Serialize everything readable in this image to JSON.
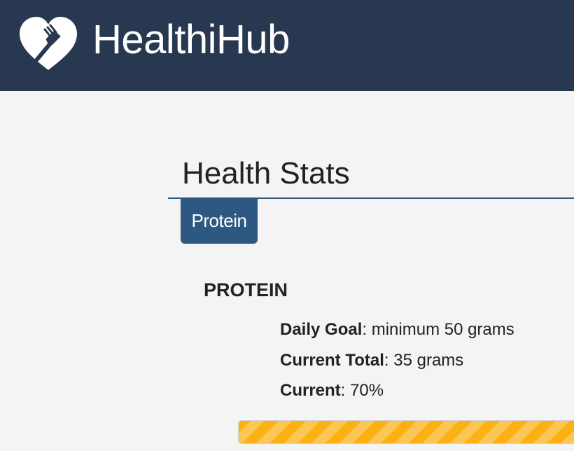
{
  "header": {
    "brand": "HealthiHub",
    "logo_icon": "heart-fork-icon",
    "background_color": "#283850"
  },
  "main": {
    "title": "Health Stats",
    "tabs": [
      {
        "label": "Protein",
        "active": true
      }
    ],
    "stat": {
      "heading": "PROTEIN",
      "rows": [
        {
          "label": "Daily Goal",
          "separator": ":",
          "value": "minimum 50 grams"
        },
        {
          "label": "Current Total",
          "separator": ":",
          "value": "35 grams"
        },
        {
          "label": "Current",
          "separator": ":",
          "value": "70%"
        }
      ],
      "progress_fraction": 0.7,
      "progress_color": "#fbb014"
    }
  }
}
